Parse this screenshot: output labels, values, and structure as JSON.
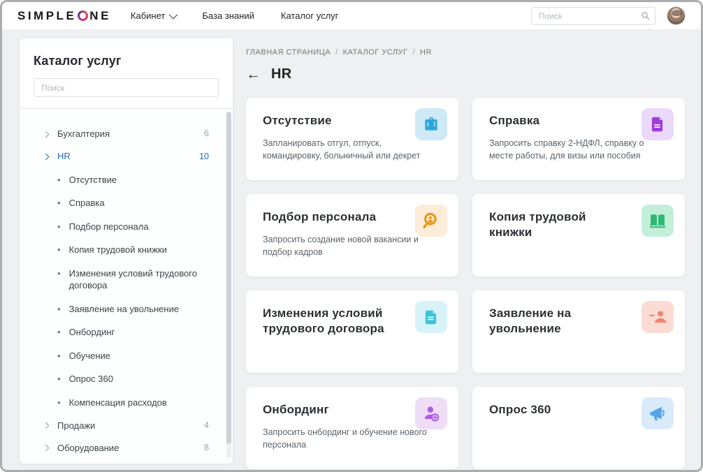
{
  "brand": {
    "accent_red": "#e0314f",
    "accent_blue": "#2b6cb0"
  },
  "header": {
    "logo": {
      "simple": "SIMPLE",
      "ne": "NE"
    },
    "nav": [
      {
        "label": "Кабинет",
        "has_dropdown": true
      },
      {
        "label": "База знаний",
        "has_dropdown": false
      },
      {
        "label": "Каталог услуг",
        "has_dropdown": false
      }
    ],
    "search_placeholder": "Поиск"
  },
  "sidebar": {
    "title": "Каталог услуг",
    "search_placeholder": "Поиск",
    "tree": [
      {
        "label": "Бухгалтерия",
        "count": "6",
        "type": "group"
      },
      {
        "label": "HR",
        "count": "10",
        "type": "group",
        "active": true
      },
      {
        "label": "Отсутствие",
        "type": "item"
      },
      {
        "label": "Справка",
        "type": "item"
      },
      {
        "label": "Подбор персонала",
        "type": "item"
      },
      {
        "label": "Копия трудовой книжки",
        "type": "item"
      },
      {
        "label": "Изменения условий трудового договора",
        "type": "item"
      },
      {
        "label": "Заявление на увольнение",
        "type": "item"
      },
      {
        "label": "Онбординг",
        "type": "item"
      },
      {
        "label": "Обучение",
        "type": "item"
      },
      {
        "label": "Опрос 360",
        "type": "item"
      },
      {
        "label": "Компенсация расходов",
        "type": "item"
      },
      {
        "label": "Продажи",
        "count": "4",
        "type": "group"
      },
      {
        "label": "Оборудование",
        "count": "8",
        "type": "group"
      }
    ]
  },
  "breadcrumb": {
    "items": [
      "ГЛАВНАЯ СТРАНИЦА",
      "КАТАЛОГ УСЛУГ",
      "HR"
    ],
    "separator": "/"
  },
  "page": {
    "title": "HR",
    "back_arrow": "←"
  },
  "cards": [
    {
      "title": "Отсутствие",
      "description": "Запланировать отгул, отпуск, командировку, больничный или декрет",
      "icon": "briefcase-icon",
      "icon_color": "#2ea7de",
      "icon_bg": "#cfe9f7"
    },
    {
      "title": "Справка",
      "description": "Запросить справку 2-НДФЛ, справку о месте работы, для визы или пособия",
      "icon": "document-icon",
      "icon_color": "#a03bdc",
      "icon_bg": "#ead9f8"
    },
    {
      "title": "Подбор персонала",
      "description": "Запросить создание новой вакансии и подбор кадров",
      "icon": "search-person-icon",
      "icon_color": "#eb9512",
      "icon_bg": "#fcecd8"
    },
    {
      "title": "Копия трудовой книжки",
      "description": "",
      "icon": "open-book-icon",
      "icon_color": "#2fb873",
      "icon_bg": "#c3efd9"
    },
    {
      "title": "Изменения условий трудового договора",
      "description": "",
      "icon": "contract-icon",
      "icon_color": "#3fc3dd",
      "icon_bg": "#d8f2f9"
    },
    {
      "title": "Заявление на увольнение",
      "description": "",
      "icon": "person-icon",
      "icon_color": "#ef8570",
      "icon_bg": "#fadcd5"
    },
    {
      "title": "Онбординг",
      "description": "Запросить онбординг и обучение нового персонала",
      "icon": "person-plus-icon",
      "icon_color": "#ae5ce8",
      "icon_bg": "#f0def9"
    },
    {
      "title": "Опрос 360",
      "description": "",
      "icon": "megaphone-icon",
      "icon_color": "#55a6e9",
      "icon_bg": "#d9eafa"
    }
  ]
}
